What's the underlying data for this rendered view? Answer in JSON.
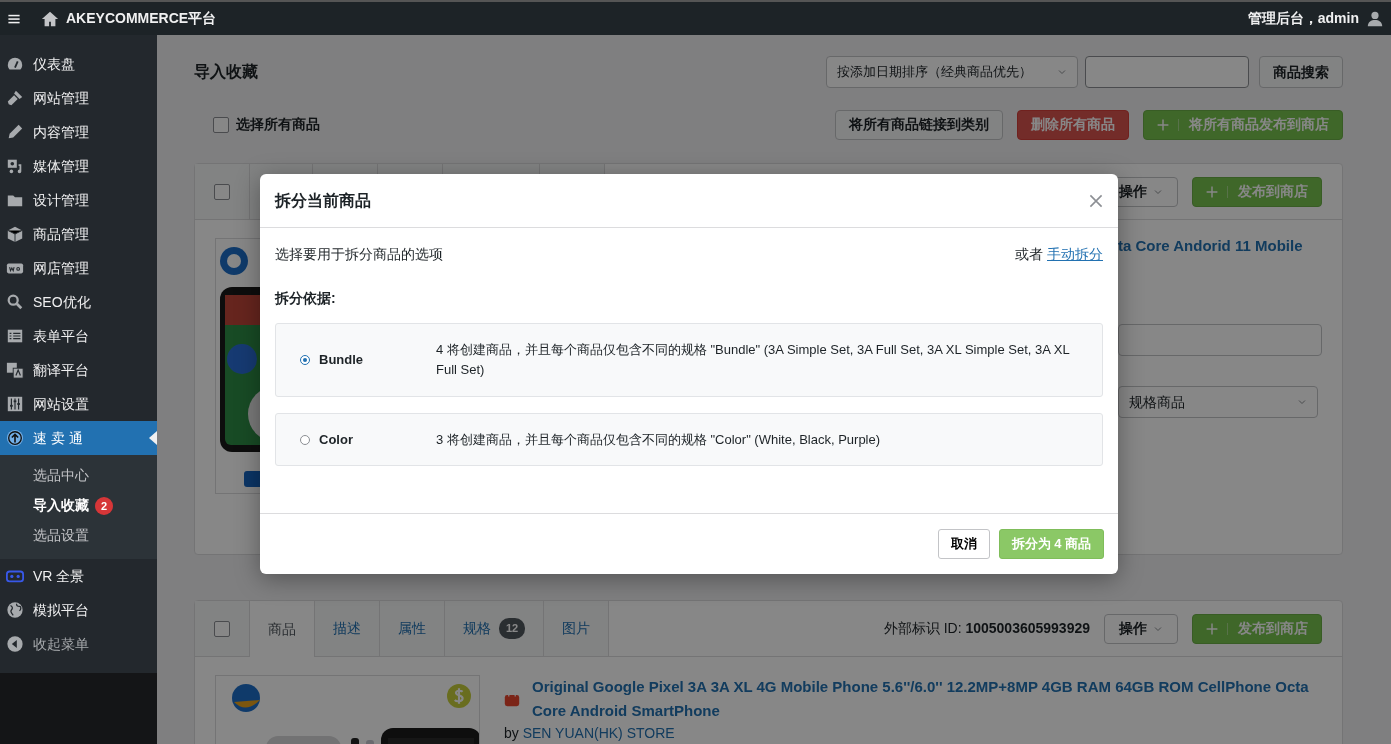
{
  "topbar": {
    "title": "AKEYCOMMERCE平台",
    "user": "管理后台，admin"
  },
  "sidebar": {
    "items": [
      {
        "label": "仪表盘",
        "kind": "menu",
        "selected": false
      },
      {
        "label": "网站管理",
        "kind": "menu",
        "selected": false
      },
      {
        "label": "内容管理",
        "kind": "menu",
        "selected": false
      },
      {
        "label": "媒体管理",
        "kind": "menu",
        "selected": false
      },
      {
        "label": "设计管理",
        "kind": "menu",
        "selected": false
      },
      {
        "label": "商品管理",
        "kind": "menu",
        "selected": false
      },
      {
        "label": "网店管理",
        "kind": "menu",
        "selected": false
      },
      {
        "label": "SEO优化",
        "kind": "menu",
        "selected": false
      },
      {
        "label": "表单平台",
        "kind": "menu",
        "selected": false
      },
      {
        "label": "翻译平台",
        "kind": "menu",
        "selected": false
      },
      {
        "label": "网站设置",
        "kind": "menu",
        "selected": false
      },
      {
        "label": "速 卖 通",
        "kind": "menu",
        "selected": true,
        "children": [
          {
            "label": "选品中心",
            "selected": false
          },
          {
            "label": "导入收藏",
            "selected": true,
            "badge": "2"
          },
          {
            "label": "选品设置",
            "selected": false
          }
        ]
      },
      {
        "label": "VR 全景",
        "kind": "menu",
        "selected": false
      },
      {
        "label": "模拟平台",
        "kind": "menu",
        "selected": false
      },
      {
        "label": "收起菜单",
        "kind": "collapse",
        "selected": false
      }
    ]
  },
  "page": {
    "title": "导入收藏",
    "sort_select": "按添加日期排序（经典商品优先）",
    "search_button": "商品搜索",
    "select_all": {
      "label": "选择所有商品",
      "checked": false
    },
    "actions": [
      {
        "label": "将所有商品链接到类别",
        "kind": "default"
      },
      {
        "label": "删除所有商品",
        "kind": "danger"
      },
      {
        "label": "将所有商品发布到商店",
        "kind": "publish"
      }
    ]
  },
  "products": [
    {
      "checked": false,
      "actions_label": "操作",
      "publish_label": "发布到商店",
      "title": "ta Core Andorid 11 Mobile",
      "type_select": "规格商品"
    },
    {
      "checked": false,
      "tabs": [
        {
          "label": "商品",
          "selected": true
        },
        {
          "label": "描述",
          "selected": false
        },
        {
          "label": "属性",
          "selected": false
        },
        {
          "label": "规格",
          "selected": false,
          "badge": "12"
        },
        {
          "label": "图片",
          "selected": false
        }
      ],
      "external_id_label": "外部标识 ID:",
      "external_id": "1005003605993929",
      "actions_label": "操作",
      "publish_label": "发布到商店",
      "title": "Original Google Pixel 3A 3A XL 4G Mobile Phone 5.6''/6.0'' 12.2MP+8MP 4GB RAM 64GB ROM CellPhone Octa Core Android SmartPhone",
      "by": "by",
      "store": "SEN YUAN(HK) STORE"
    }
  ],
  "modal": {
    "title": "拆分当前商品",
    "prompt": "选择要用于拆分商品的选项",
    "alt_prefix": "或者",
    "alt_link": "手动拆分",
    "split_by_label": "拆分依据:",
    "options": [
      {
        "name": "Bundle",
        "description": "4 将创建商品，并且每个商品仅包含不同的规格 \"Bundle\" (3A Simple Set, 3A Full Set, 3A XL Simple Set, 3A XL Full Set)",
        "selected": true
      },
      {
        "name": "Color",
        "description": "3 将创建商品，并且每个商品仅包含不同的规格 \"Color\" (White, Black, Purple)",
        "selected": false
      }
    ],
    "cancel": "取消",
    "confirm": "拆分为 4 商品"
  }
}
